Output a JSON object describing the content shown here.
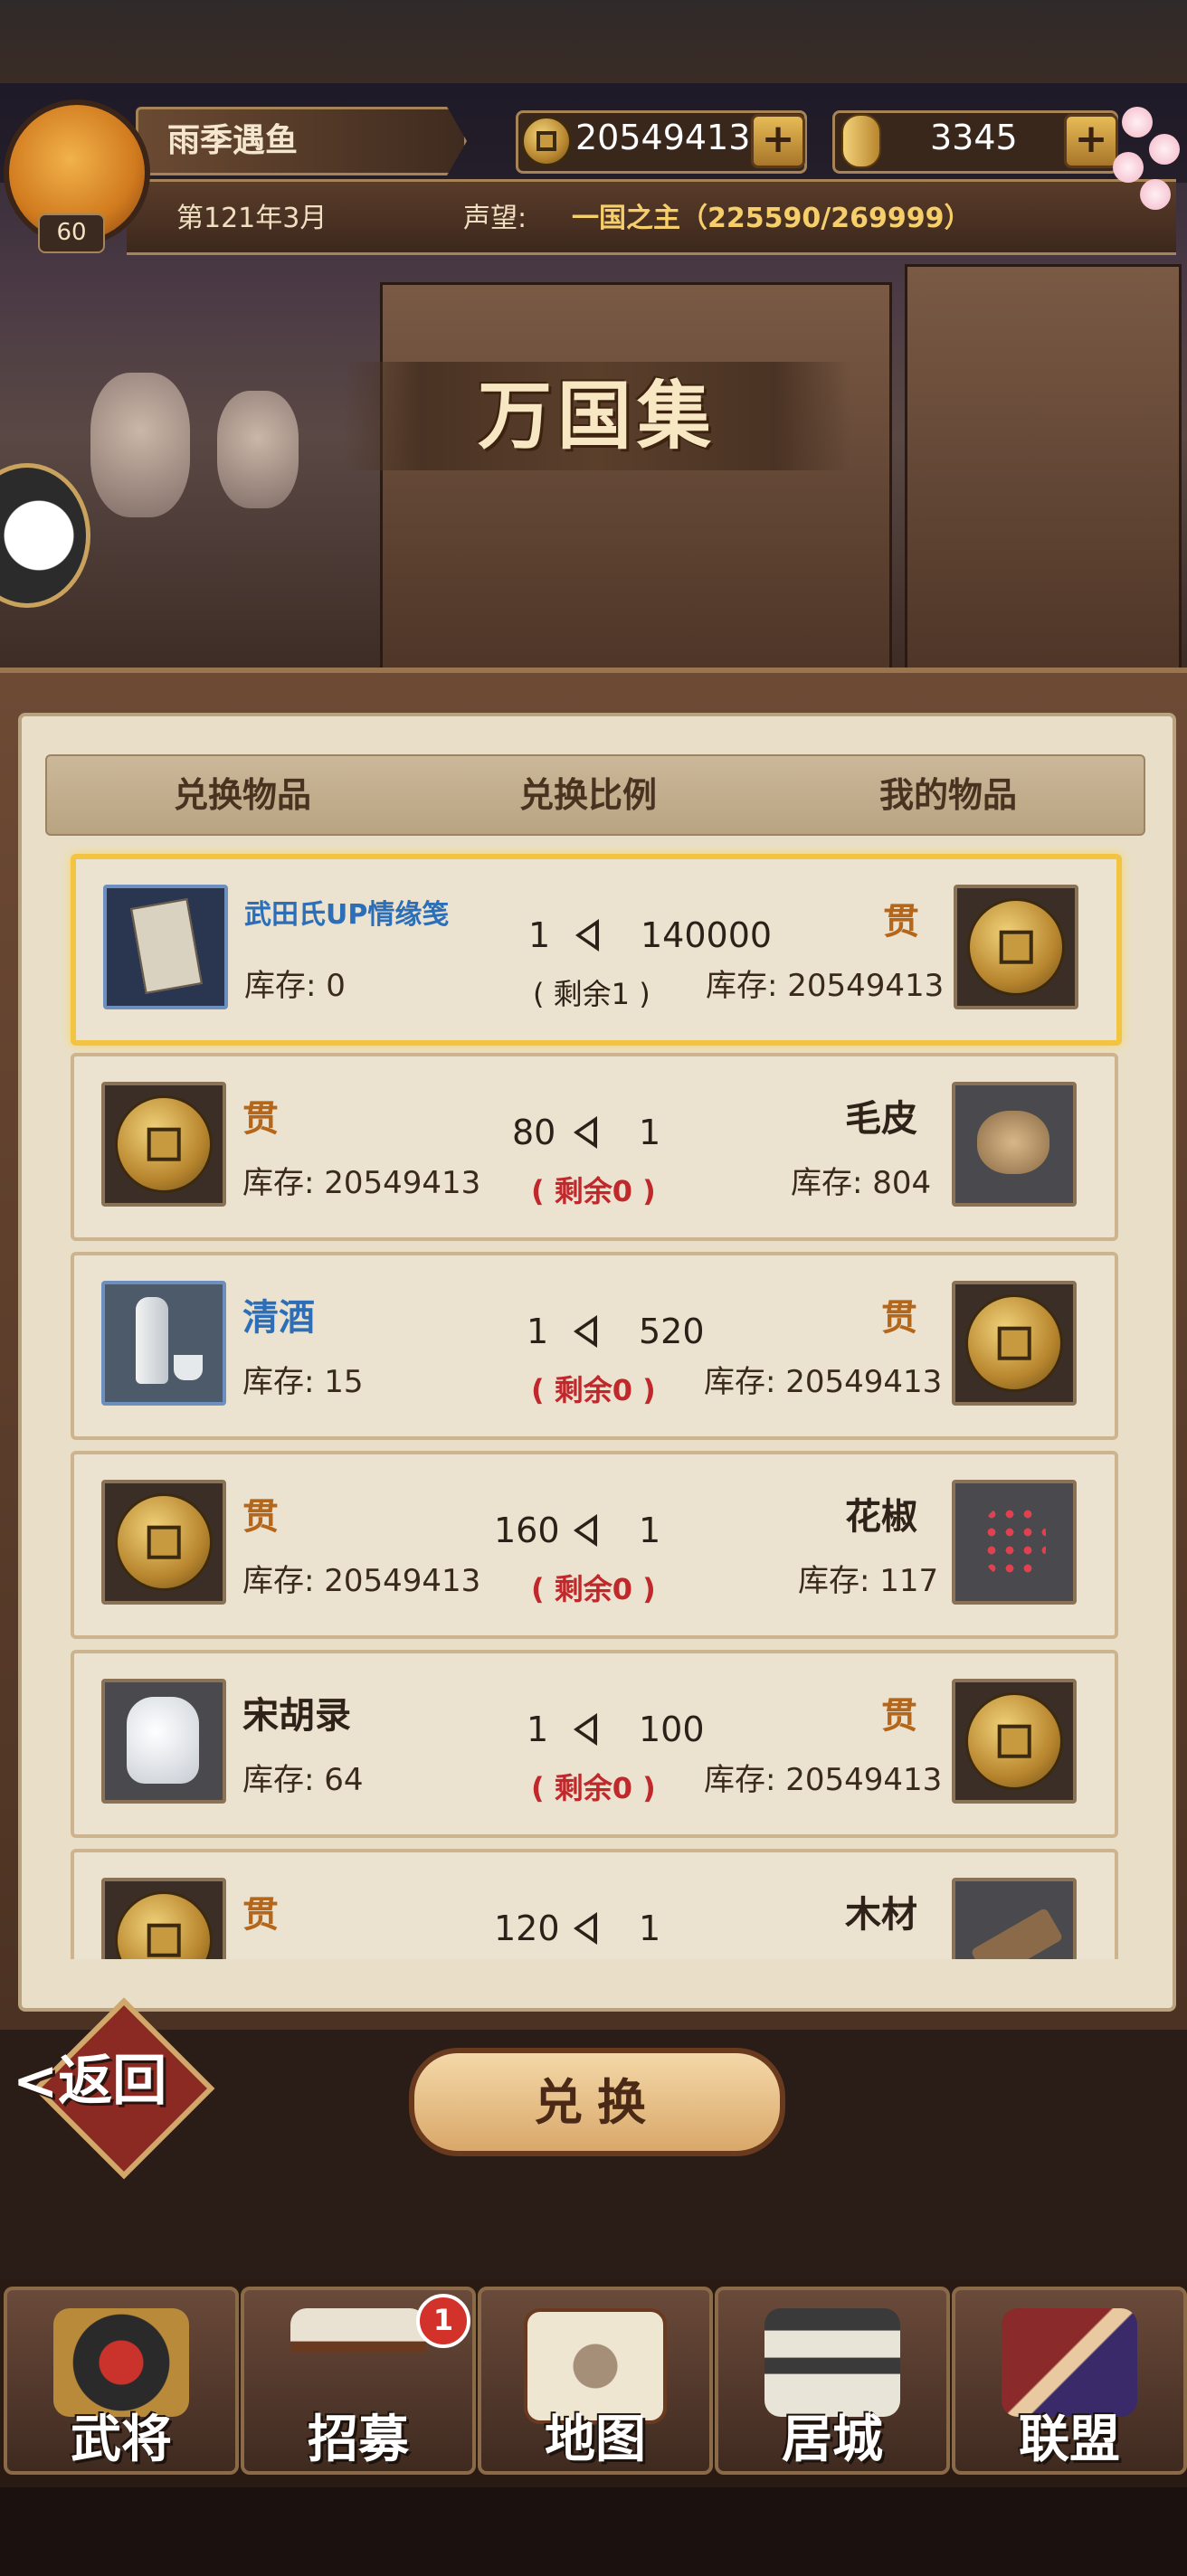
{
  "player": {
    "name": "雨季遇鱼",
    "level": "60",
    "date": "第121年3月",
    "prestige_label": "声望:",
    "prestige_value": "一国之主（225590/269999）"
  },
  "resources": {
    "coins": "20549413",
    "gold": "3345",
    "plus_symbol": "+"
  },
  "page_title": "万国集",
  "columns": {
    "exchange_item": "兑换物品",
    "exchange_ratio": "兑换比例",
    "my_item": "我的物品"
  },
  "rows": [
    {
      "left_name": "武田氏UP情缘笺",
      "left_stock": "库存: 0",
      "ratio_left": "1",
      "ratio_right": "140000",
      "remain": "( 剩余1 )",
      "right_name": "贯",
      "right_stock": "库存: 20549413"
    },
    {
      "left_name": "贯",
      "left_stock": "库存: 20549413",
      "ratio_left": "80",
      "ratio_right": "1",
      "remain": "( 剩余0 )",
      "right_name": "毛皮",
      "right_stock": "库存: 804"
    },
    {
      "left_name": "清酒",
      "left_stock": "库存: 15",
      "ratio_left": "1",
      "ratio_right": "520",
      "remain": "( 剩余0 )",
      "right_name": "贯",
      "right_stock": "库存: 20549413"
    },
    {
      "left_name": "贯",
      "left_stock": "库存: 20549413",
      "ratio_left": "160",
      "ratio_right": "1",
      "remain": "( 剩余0 )",
      "right_name": "花椒",
      "right_stock": "库存: 117"
    },
    {
      "left_name": "宋胡录",
      "left_stock": "库存: 64",
      "ratio_left": "1",
      "ratio_right": "100",
      "remain": "( 剩余0 )",
      "right_name": "贯",
      "right_stock": "库存: 20549413"
    },
    {
      "left_name": "贯",
      "left_stock": "",
      "ratio_left": "120",
      "ratio_right": "1",
      "remain": "",
      "right_name": "木材",
      "right_stock": ""
    }
  ],
  "buttons": {
    "back": "返回",
    "exchange": "兑换"
  },
  "nav": {
    "items": [
      "武将",
      "招募",
      "地图",
      "居城",
      "联盟"
    ],
    "badge_count": "1"
  },
  "colors": {
    "accent_gold": "#f3c441",
    "remain_red": "#c0282b",
    "item_orange": "#b4661a",
    "item_blue": "#2c6fb8"
  }
}
